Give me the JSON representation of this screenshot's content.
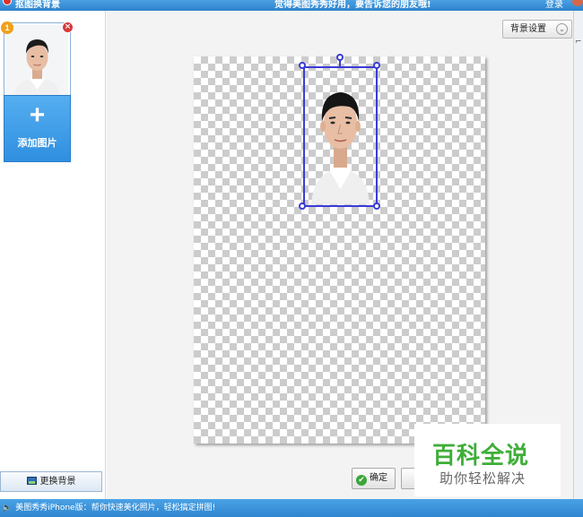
{
  "titlebar": {
    "app_title": "抠图换背景",
    "promo": "觉得美图秀秀好用，要告诉您的朋友哦!",
    "login": "登录"
  },
  "left_panel": {
    "thumb_number": "1",
    "close_glyph": "×",
    "add_plus": "+",
    "add_label": "添加图片",
    "change_bg_label": "更换背景"
  },
  "workspace": {
    "bg_settings_label": "背景设置",
    "bg_settings_chevron": "⌄",
    "confirm_label": "确定",
    "confirm_glyph": "✔"
  },
  "watermark": {
    "main": "百科全说",
    "sub": "助你轻松解决"
  },
  "right_strip": {
    "glyph": "⌐"
  },
  "statusbar": {
    "speaker": "🔈",
    "text": "美图秀秀iPhone版：帮你快速美化照片，轻松搞定拼图!"
  },
  "colors": {
    "titlebar": "#2d82cc",
    "accent_blue": "#2f8fe0",
    "selection": "#3b3bd6",
    "watermark_green": "#3fae39"
  }
}
